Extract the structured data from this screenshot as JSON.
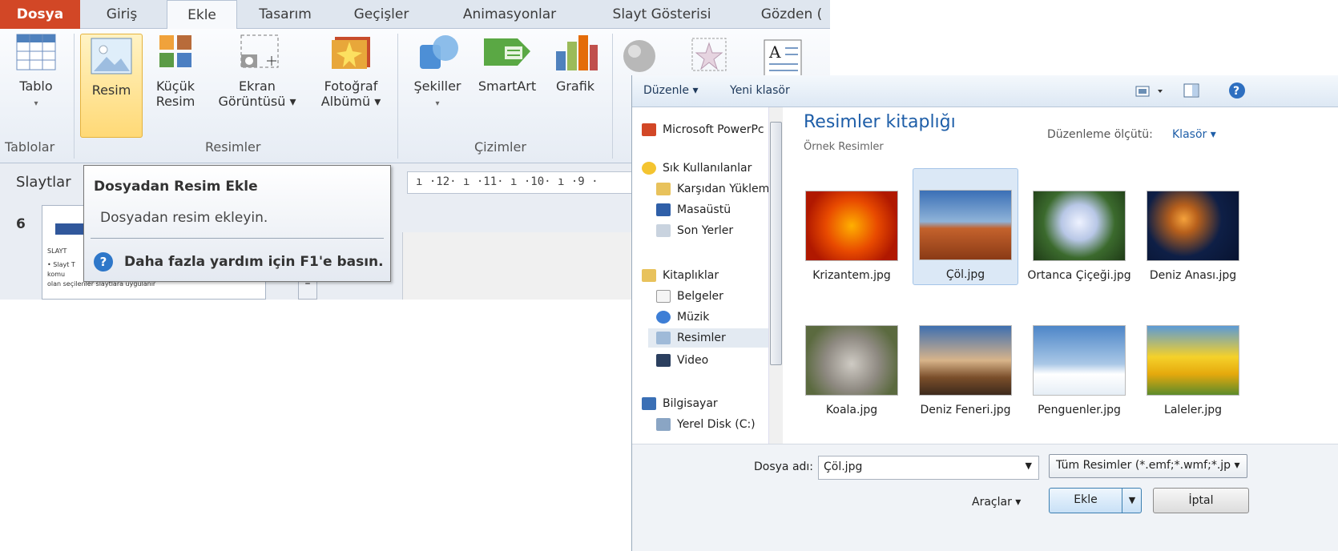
{
  "ribbon": {
    "tabs": [
      "Dosya",
      "Giriş",
      "Ekle",
      "Tasarım",
      "Geçişler",
      "Animasyonlar",
      "Slayt Gösterisi",
      "Gözden ("
    ],
    "buttons": {
      "tablo": "Tablo",
      "resim": "Resim",
      "kucuk_resim_1": "Küçük",
      "kucuk_resim_2": "Resim",
      "ekran_1": "Ekran",
      "ekran_2": "Görüntüsü ▾",
      "album_1": "Fotoğraf",
      "album_2": "Albümü ▾",
      "sekiller": "Şekiller",
      "smartart": "SmartArt",
      "grafik": "Grafik"
    },
    "groups": {
      "tablolar": "Tablolar",
      "resimler": "Resimler",
      "cizimler": "Çizimler"
    }
  },
  "slides_panel": {
    "tab_label": "Slaytlar",
    "slide_number": "6",
    "thumb_line1": "SLAYT",
    "thumb_line2": "• Slayt T\nkomu\nolan seçilenler slaytlara uygulanır"
  },
  "ruler": {
    "text": "ı ·12· ı ·11· ı ·10· ı ·9 ·"
  },
  "tooltip": {
    "title": "Dosyadan Resim Ekle",
    "body": "Dosyadan resim ekleyin.",
    "help": "Daha fazla yardım için F1'e basın."
  },
  "dialog": {
    "toolbar": {
      "organize": "Düzenle ▾",
      "new_folder": "Yeni klasör"
    },
    "nav": {
      "items": [
        "Microsoft PowerPc",
        "Sık Kullanılanlar",
        "Karşıdan Yüklem",
        "Masaüstü",
        "Son Yerler",
        "Kitaplıklar",
        "Belgeler",
        "Müzik",
        "Resimler",
        "Video",
        "Bilgisayar",
        "Yerel Disk (C:)"
      ]
    },
    "library": {
      "title": "Resimler kitaplığı",
      "subtitle": "Örnek Resimler",
      "arrange_label": "Düzenleme ölçütü:",
      "arrange_value": "Klasör ▾"
    },
    "files": [
      {
        "name": "Krizantem.jpg"
      },
      {
        "name": "Çöl.jpg"
      },
      {
        "name": "Ortanca Çiçeği.jpg"
      },
      {
        "name": "Deniz Anası.jpg"
      },
      {
        "name": "Koala.jpg"
      },
      {
        "name": "Deniz Feneri.jpg"
      },
      {
        "name": "Penguenler.jpg"
      },
      {
        "name": "Laleler.jpg"
      }
    ],
    "footer": {
      "filename_label": "Dosya adı:",
      "filename_value": "Çöl.jpg",
      "filetype_value": "Tüm Resimler (*.emf;*.wmf;*.jp ▾",
      "tools_label": "Araçlar  ▾",
      "open_label": "Ekle",
      "cancel_label": "İptal"
    }
  },
  "colors": {
    "file_tab": "#d24726",
    "accent": "#1e5ea8",
    "selection": "#dbe8f6"
  }
}
